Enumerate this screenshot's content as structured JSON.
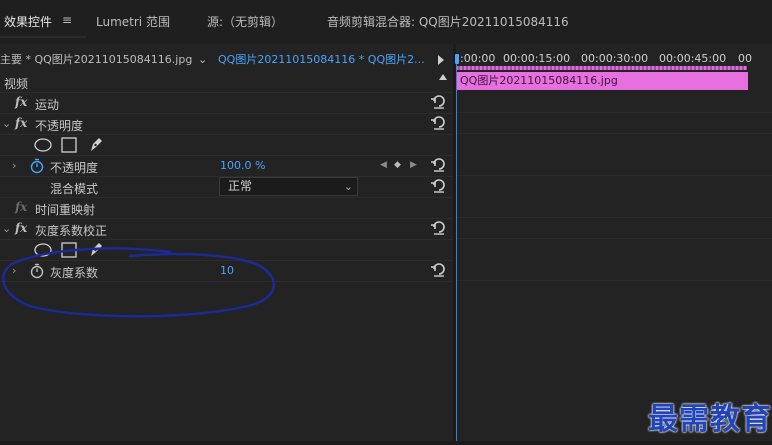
{
  "tabs": {
    "effect_controls": "效果控件",
    "effect_controls_menu": "≡",
    "lumetri": "Lumetri 范围",
    "source": "源:（无剪辑）",
    "audio_mixer": "音频剪辑混合器: QQ图片20211015084116"
  },
  "header": {
    "master_clip": "主要 * QQ图片20211015084116.jpg",
    "sequence_clip": "QQ图片20211015084116 * QQ图片2...",
    "chevron": "⌄"
  },
  "timeline": {
    "ticks": [
      ":00:00",
      "00:00:15:00",
      "00:00:30:00",
      "00:00:45:00",
      "00"
    ],
    "clip_name": "QQ图片20211015084116.jpg"
  },
  "effects": {
    "section_video": "视频",
    "motion": "运动",
    "opacity": "不透明度",
    "opacity_param": "不透明度",
    "opacity_value": "100.0 %",
    "blend_mode": "混合模式",
    "blend_mode_value": "正常",
    "time_remap": "时间重映射",
    "gamma_correction": "灰度系数校正",
    "gamma_param": "灰度系数",
    "gamma_value": "10",
    "fx": "fx"
  },
  "watermark": "最需教育",
  "colors": {
    "accent_blue": "#4aa3ff",
    "clip_pink": "#e86fe0",
    "annotation": "#1a2a9a"
  }
}
